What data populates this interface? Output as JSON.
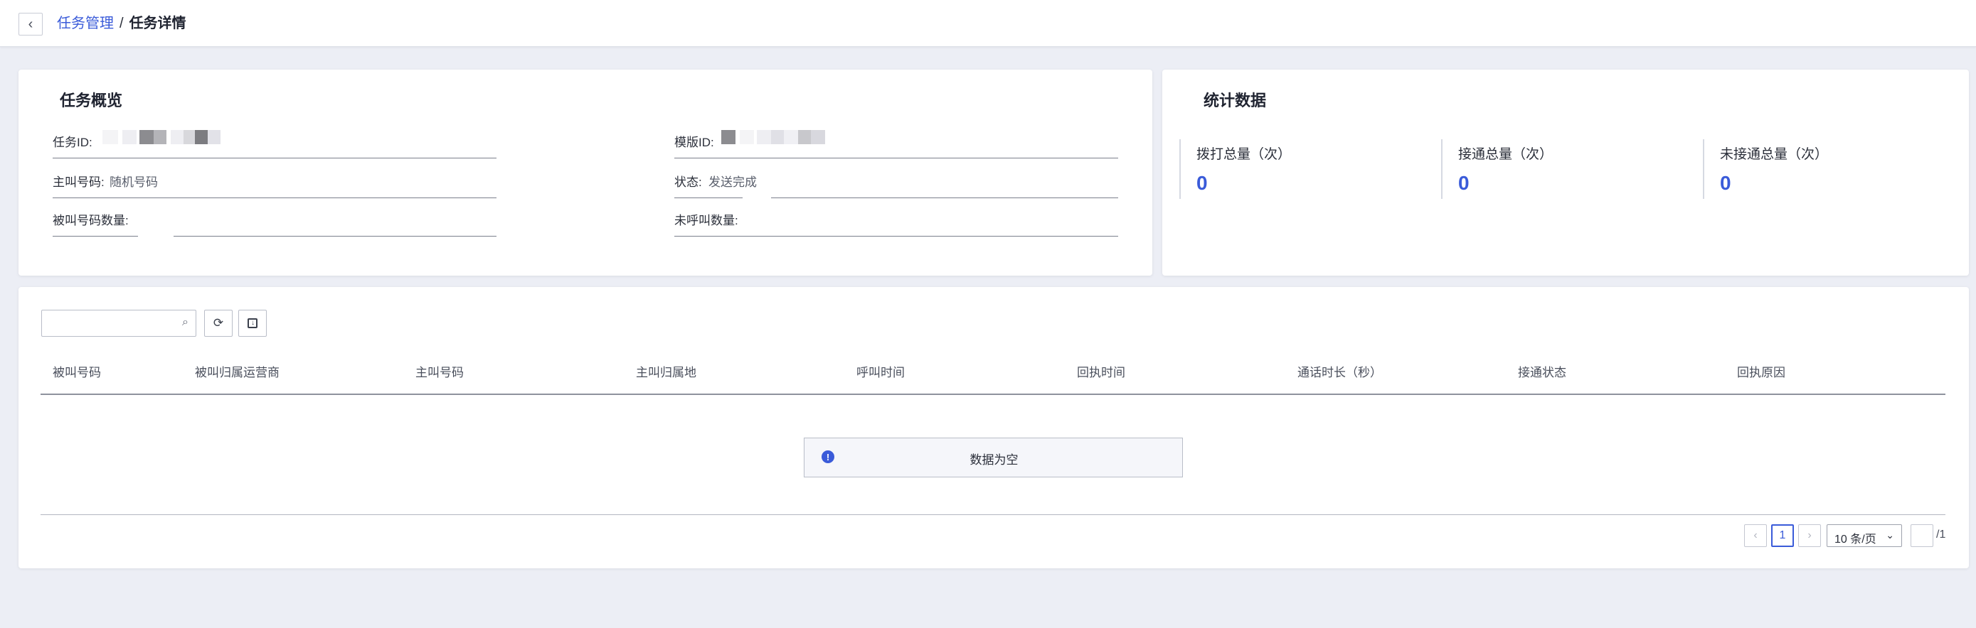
{
  "breadcrumb": {
    "back_icon": "chevron-left-icon",
    "parent": "任务管理",
    "separator": "/",
    "current": "任务详情"
  },
  "overview": {
    "title": "任务概览",
    "task_id_label": "任务ID:",
    "template_id_label": "模版ID:",
    "caller_label": "主叫号码:",
    "caller_value": "随机号码",
    "status_label": "状态:",
    "status_value": "发送完成",
    "callee_count_label": "被叫号码数量:",
    "uncalled_count_label": "未呼叫数量:"
  },
  "stats": {
    "title": "统计数据",
    "items": [
      {
        "label": "拨打总量（次）",
        "value": "0"
      },
      {
        "label": "接通总量（次）",
        "value": "0"
      },
      {
        "label": "未接通总量（次）",
        "value": "0"
      }
    ]
  },
  "toolbar": {
    "search_placeholder": "",
    "search_icon": "search-icon",
    "refresh_icon": "refresh-icon",
    "export_icon": "export-icon"
  },
  "table": {
    "columns": [
      "被叫号码",
      "被叫归属运营商",
      "主叫号码",
      "主叫归属地",
      "呼叫时间",
      "回执时间",
      "通话时长（秒）",
      "接通状态",
      "回执原因"
    ],
    "rows": [],
    "empty_text": "数据为空",
    "empty_icon": "info-icon"
  },
  "pagination": {
    "prev": "‹",
    "next": "›",
    "current_page": "1",
    "page_size": "10 条/页",
    "total_pages": "/1"
  },
  "colors": {
    "accent": "#3a5bd9",
    "background": "#eceef5"
  }
}
